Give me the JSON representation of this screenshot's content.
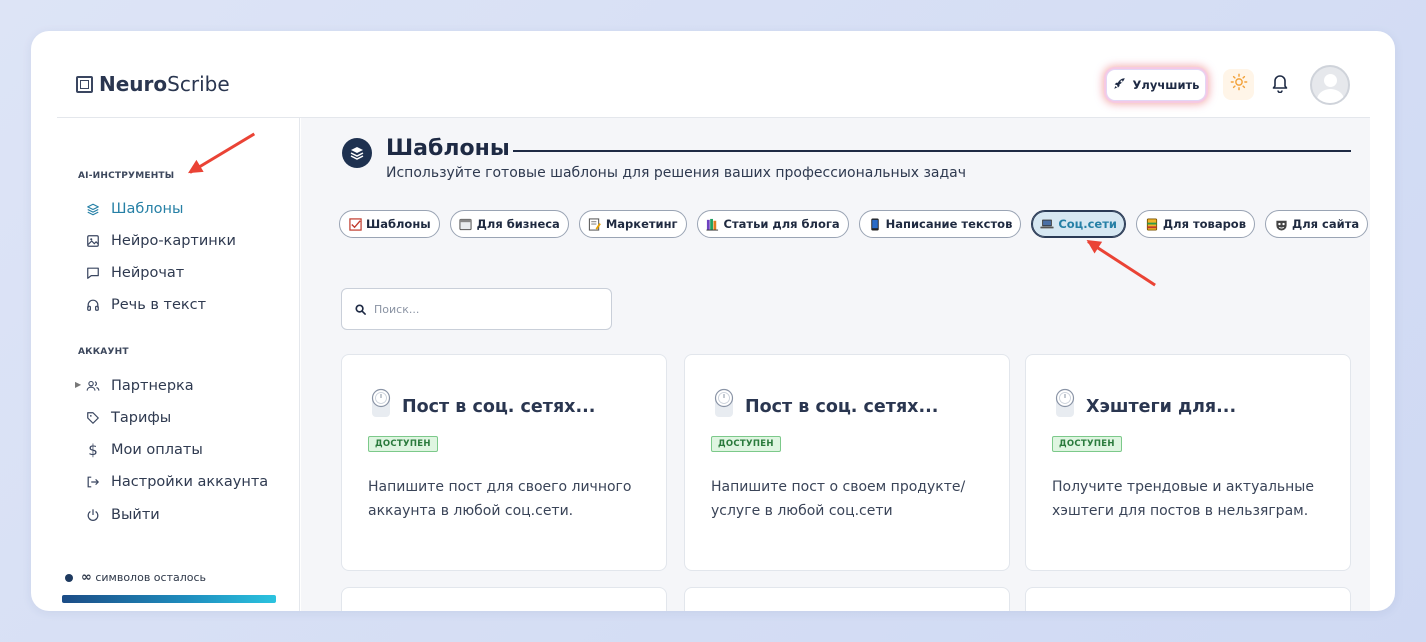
{
  "app": {
    "logo_bold": "Neuro",
    "logo_light": "Scribe",
    "upgrade_label": "Улучшить"
  },
  "sidebar": {
    "section_tools": "AI-ИНСТРУМЕНТЫ",
    "tools": [
      {
        "label": "Шаблоны",
        "icon": "layers-icon",
        "active": true
      },
      {
        "label": "Нейро-картинки",
        "icon": "image-icon"
      },
      {
        "label": "Нейрочат",
        "icon": "chat-icon"
      },
      {
        "label": "Речь в текст",
        "icon": "headphones-icon"
      }
    ],
    "section_account": "АККАУНТ",
    "account": [
      {
        "label": "Партнерка",
        "icon": "users-icon"
      },
      {
        "label": "Тарифы",
        "icon": "tag-icon"
      },
      {
        "label": "Мои оплаты",
        "icon": "dollar-icon"
      },
      {
        "label": "Настройки аккаунта",
        "icon": "logout-arrow-icon"
      },
      {
        "label": "Выйти",
        "icon": "power-icon"
      }
    ],
    "credits_symbol": "∞",
    "credits_text": "символов осталось"
  },
  "main": {
    "title": "Шаблоны",
    "subtitle": "Используйте готовые шаблоны для решения ваших профессиональных задач",
    "chips": [
      {
        "label": "Шаблоны",
        "icon": "checkbox-icon"
      },
      {
        "label": "Для бизнеса",
        "icon": "calendar-icon"
      },
      {
        "label": "Маркетинг",
        "icon": "memo-icon"
      },
      {
        "label": "Статьи для блога",
        "icon": "books-icon"
      },
      {
        "label": "Написание текстов",
        "icon": "phone-icon"
      },
      {
        "label": "Соц.сети",
        "icon": "laptop-icon",
        "active": true
      },
      {
        "label": "Для товаров",
        "icon": "ledger-icon"
      },
      {
        "label": "Для сайта",
        "icon": "mask-icon"
      }
    ],
    "search_placeholder": "Поиск...",
    "cards": [
      {
        "title": "Пост в соц. сетях...",
        "badge": "ДОСТУПЕН",
        "desc": "Напишите пост для своего личного аккаунта в любой соц.сети."
      },
      {
        "title": "Пост в соц. сетях...",
        "badge": "ДОСТУПЕН",
        "desc": "Напишите пост о своем продукте/ услуге в любой соц.сети"
      },
      {
        "title": "Хэштеги для...",
        "badge": "ДОСТУПЕН",
        "desc": "Получите трендовые и актуальные хэштеги для постов в нельзяграм."
      }
    ]
  },
  "colors": {
    "accent": "#2680a6",
    "annotation_arrow": "#ea4335",
    "badge_bg": "#dff5e1"
  }
}
